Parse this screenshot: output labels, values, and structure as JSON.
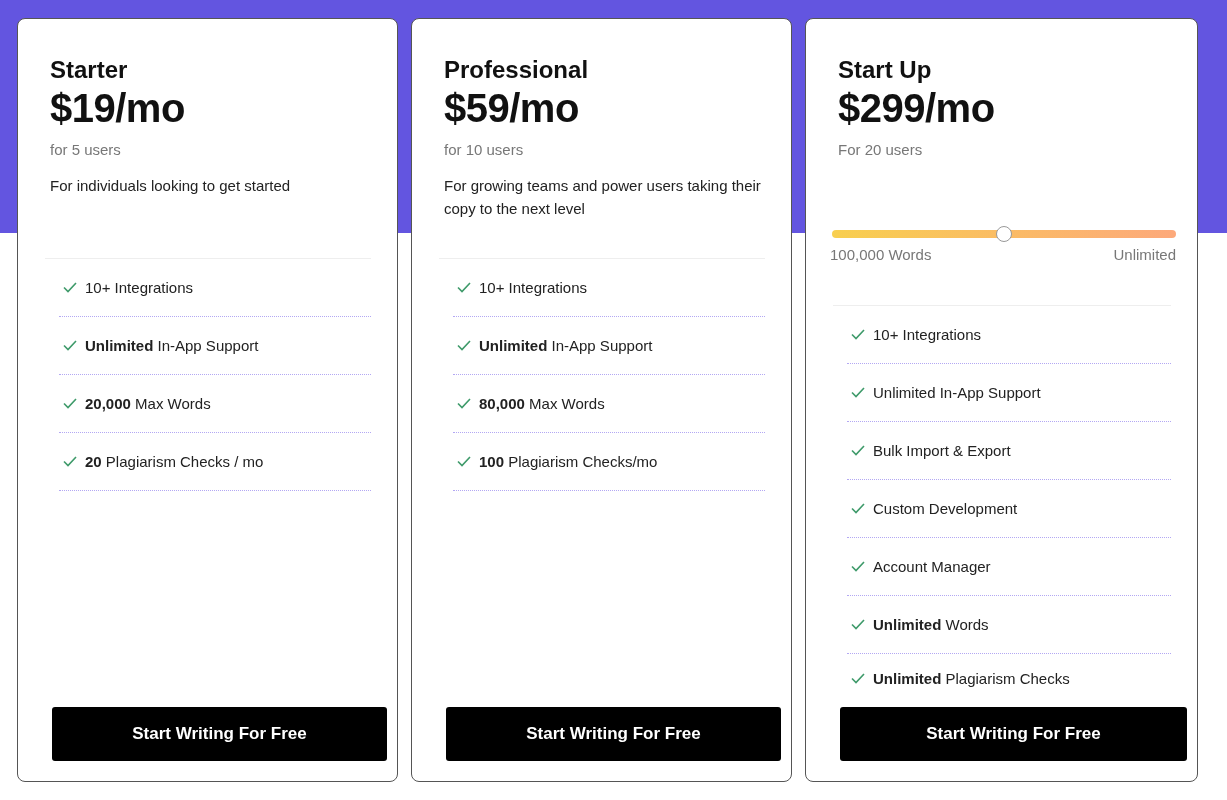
{
  "plans": [
    {
      "name": "Starter",
      "price": "$19/mo",
      "users": "for 5 users",
      "description": "For individuals looking to get started",
      "features": [
        "10+ Integrations",
        "**Unlimited** In-App Support",
        "**20,000** Max Words",
        "**20** Plagiarism Checks / mo"
      ],
      "button": "Start Writing For Free"
    },
    {
      "name": "Professional",
      "price": "$59/mo",
      "users": "for 10 users",
      "description": "For growing teams and power users taking their copy to the next level",
      "features": [
        "10+ Integrations",
        "**Unlimited** In-App Support",
        "**80,000** Max Words",
        "**100** Plagiarism Checks/mo"
      ],
      "button": "Start Writing For Free"
    },
    {
      "name": "Start Up",
      "price": "$299/mo",
      "users": "For 20 users",
      "slider": {
        "level": 0.5,
        "min_label": "100,000 Words",
        "max_label": "Unlimited"
      },
      "features": [
        "10+ Integrations",
        "Unlimited In-App Support",
        "Bulk Import & Export",
        "Custom Development",
        "Account Manager",
        "**Unlimited** Words",
        "**Unlimited** Plagiarism Checks"
      ],
      "button": "Start Writing For Free"
    }
  ]
}
